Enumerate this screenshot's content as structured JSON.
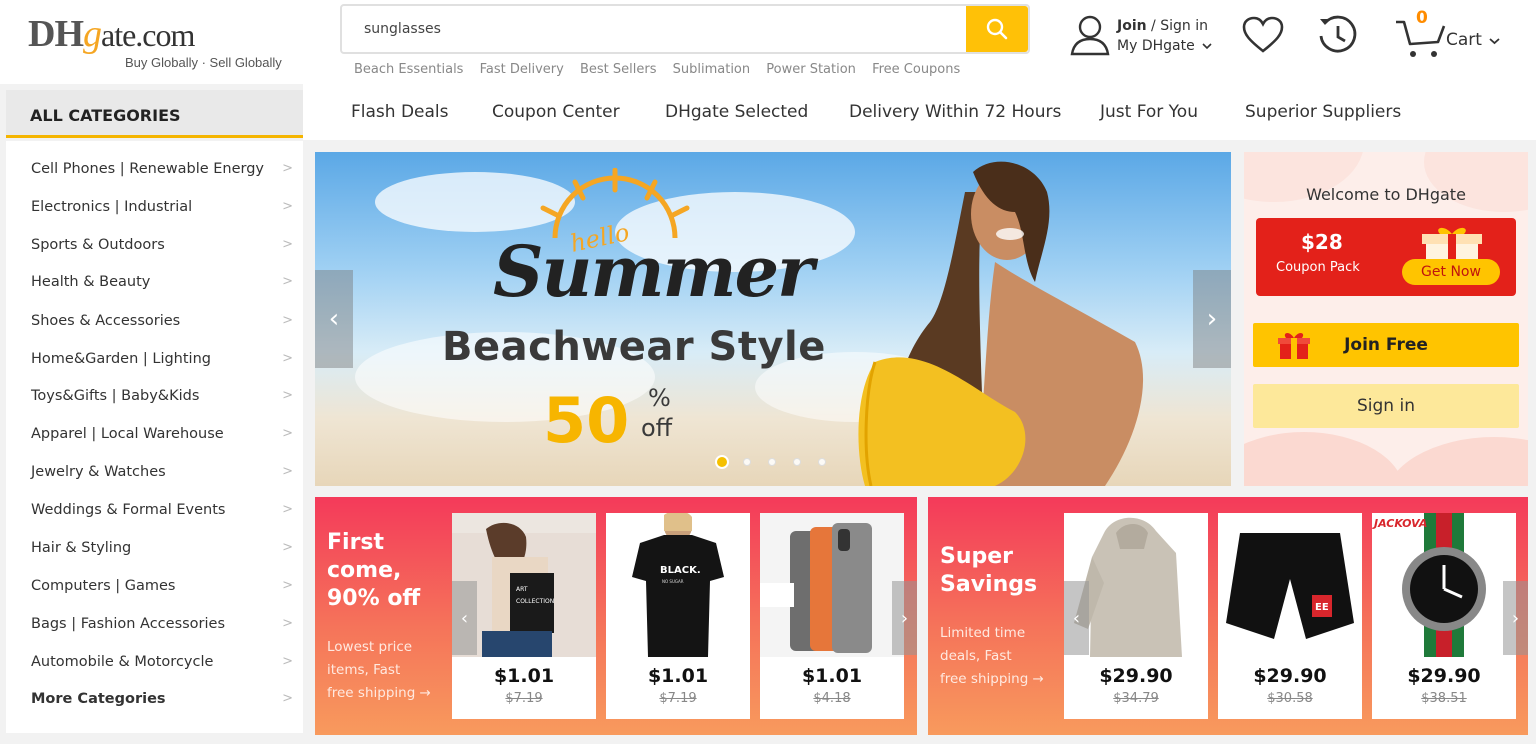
{
  "header": {
    "logo": {
      "part1": "DH",
      "part2": "g",
      "part3": "ate",
      "part4": ".com",
      "tagline": "Buy Globally · Sell Globally"
    },
    "search": {
      "value": "sunglasses",
      "hot_words": [
        "Beach Essentials",
        "Fast Delivery",
        "Best Sellers",
        "Sublimation",
        "Power Station",
        "Free Coupons"
      ]
    },
    "account": {
      "join": "Join",
      "sep": " / Sign in",
      "my": "My DHgate"
    },
    "cart": {
      "count": "0",
      "label": "Cart"
    }
  },
  "categories": {
    "title": "ALL CATEGORIES",
    "items": [
      "Cell Phones  |  Renewable Energy",
      "Electronics  |  Industrial",
      "Sports & Outdoors",
      "Health & Beauty",
      "Shoes & Accessories",
      "Home&Garden  |  Lighting",
      "Toys&Gifts  |  Baby&Kids",
      "Apparel  |  Local Warehouse",
      "Jewelry & Watches",
      "Weddings & Formal Events",
      "Hair & Styling",
      "Computers  |  Games",
      "Bags  |  Fashion Accessories",
      "Automobile & Motorcycle"
    ],
    "more": "More Categories"
  },
  "nav": {
    "items": [
      "Flash Deals",
      "Coupon Center",
      "DHgate Selected",
      "Delivery Within 72 Hours",
      "Just For You",
      "Superior Suppliers"
    ]
  },
  "banner": {
    "hello": "hello",
    "summer": "Summer",
    "style": "Beachwear Style",
    "percent": "50",
    "percent_symbol": "%",
    "off": "off",
    "active_slide": 1,
    "slides": 5
  },
  "welcome": {
    "title": "Welcome to DHgate",
    "coupon_amount": "$28",
    "coupon_label": "Coupon Pack",
    "get_now": "Get Now",
    "join_free": "Join Free",
    "sign_in": "Sign in"
  },
  "promos": [
    {
      "title_lines": [
        "First",
        "come,",
        "90% off"
      ],
      "sub_lines": [
        "Lowest price",
        "items, Fast",
        "free shipping →"
      ],
      "products": [
        {
          "price": "$1.01",
          "old_price": "$7.19",
          "image": "tote-bag"
        },
        {
          "price": "$1.01",
          "old_price": "$7.19",
          "image": "black-tshirt"
        },
        {
          "price": "$1.01",
          "old_price": "$4.18",
          "image": "phone-cases"
        }
      ]
    },
    {
      "title_lines": [
        "Super",
        "Savings"
      ],
      "sub_lines": [
        "Limited time",
        "deals, Fast",
        "free shipping →"
      ],
      "products": [
        {
          "price": "$29.90",
          "old_price": "$34.79",
          "image": "fleece-hoodie"
        },
        {
          "price": "$29.90",
          "old_price": "$30.58",
          "image": "black-shorts"
        },
        {
          "price": "$29.90",
          "old_price": "$38.51",
          "image": "wrist-watch",
          "caption": "JACKOVA"
        }
      ]
    }
  ],
  "colors": {
    "accent": "#ffc107",
    "promo_red": "#f43a5a",
    "coupon_red": "#e3211a",
    "cart_count": "#ff8c00"
  }
}
